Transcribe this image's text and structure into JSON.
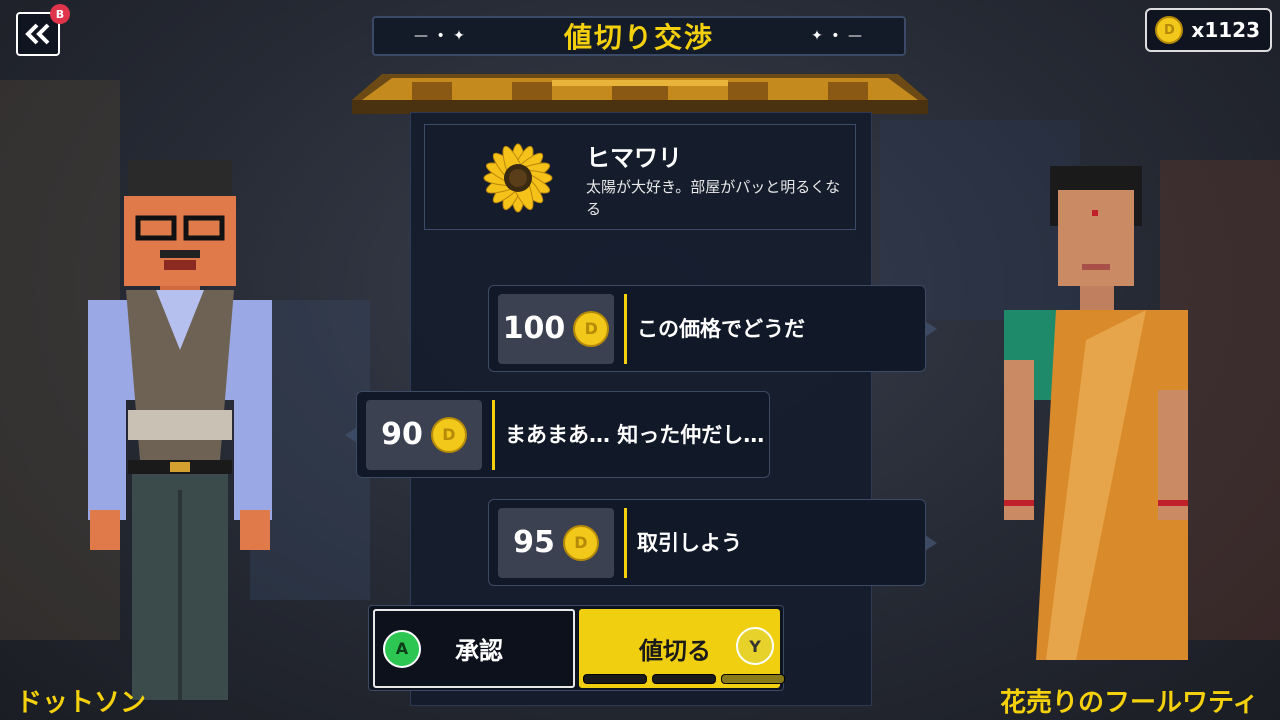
{
  "header": {
    "title": "値切り交渉",
    "deco_left": "— • ✦",
    "deco_right": "✦ • —",
    "back_badge": "B"
  },
  "wallet": {
    "coin_symbol": "D",
    "count": "x1123"
  },
  "item": {
    "name": "ヒマワリ",
    "description": "太陽が大好き。部屋がパッと明るくなる",
    "icon": "sunflower-icon"
  },
  "offers": [
    {
      "price": "100",
      "message": "この価格でどうだ",
      "side": "player"
    },
    {
      "price": "90",
      "message": "まあまあ… 知った仲だし…",
      "side": "seller"
    },
    {
      "price": "95",
      "message": "取引しよう",
      "side": "player"
    }
  ],
  "actions": {
    "accept": {
      "key": "A",
      "label": "承認"
    },
    "bargain": {
      "key": "Y",
      "label": "値切る",
      "attempts_total": 3,
      "attempts_remaining": 2
    }
  },
  "characters": {
    "player": "ドットソン",
    "seller": "花売りのフールワティ"
  },
  "colors": {
    "accent": "#f4d10c",
    "panel": "#151c2c",
    "coin": "#f2c81a",
    "accept_key": "#2dc653"
  }
}
